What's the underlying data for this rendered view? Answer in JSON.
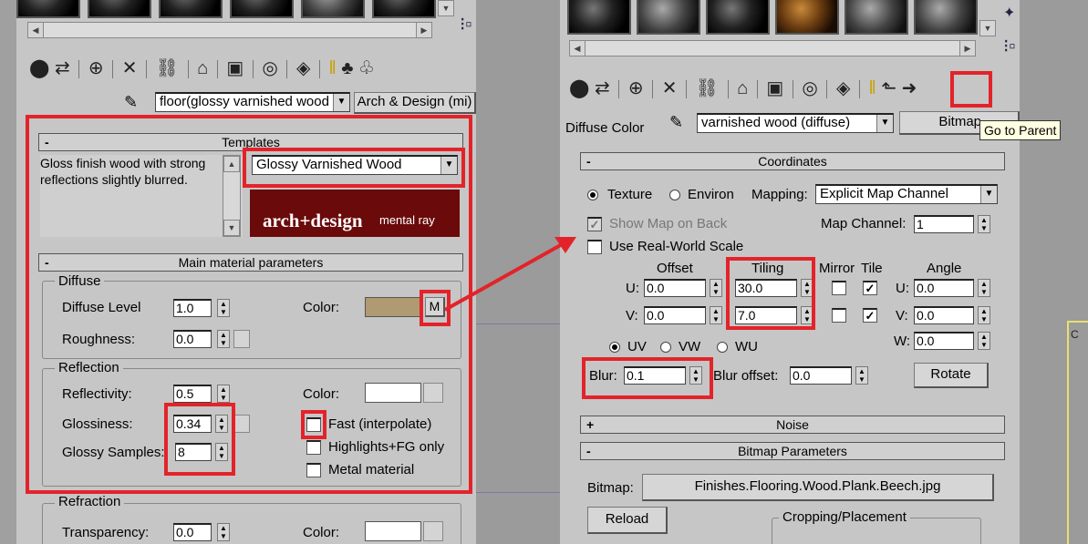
{
  "left": {
    "material_name": "floor(glossy varnished wood",
    "material_type": "Arch & Design (mi)",
    "templates": {
      "title": "Templates",
      "description": "Gloss finish wood with strong reflections slightly blurred.",
      "preset": "Glossy Varnished Wood",
      "logo_main": "arch+design",
      "logo_sub": "mental ray"
    },
    "main_params": {
      "title": "Main material parameters",
      "diffuse": {
        "group": "Diffuse",
        "level_label": "Diffuse Level",
        "level_value": "1.0",
        "roughness_label": "Roughness:",
        "roughness_value": "0.0",
        "color_label": "Color:",
        "color": "#b09a72",
        "map_button": "M"
      },
      "reflection": {
        "group": "Reflection",
        "reflectivity_label": "Reflectivity:",
        "reflectivity_value": "0.5",
        "glossiness_label": "Glossiness:",
        "glossiness_value": "0.34",
        "samples_label": "Glossy Samples:",
        "samples_value": "8",
        "color_label": "Color:",
        "fast_label": "Fast (interpolate)",
        "highlights_label": "Highlights+FG only",
        "metal_label": "Metal material"
      },
      "refraction": {
        "group": "Refraction",
        "transparency_label": "Transparency:",
        "transparency_value": "0.0",
        "color_label": "Color:"
      }
    }
  },
  "right": {
    "slot_label": "Diffuse Color",
    "map_name": "varnished wood (diffuse)",
    "map_type": "Bitmap",
    "tooltip": "Go to Parent",
    "coordinates": {
      "title": "Coordinates",
      "texture_label": "Texture",
      "environ_label": "Environ",
      "mapping_label": "Mapping:",
      "mapping_value": "Explicit Map Channel",
      "show_map_label": "Show Map on Back",
      "map_channel_label": "Map Channel:",
      "map_channel_value": "1",
      "real_world_label": "Use Real-World Scale",
      "offset_header": "Offset",
      "tiling_header": "Tiling",
      "mirror_header": "Mirror",
      "tile_header": "Tile",
      "angle_header": "Angle",
      "u_label": "U:",
      "v_label": "V:",
      "w_label": "W:",
      "u_offset": "0.0",
      "v_offset": "0.0",
      "u_tiling": "30.0",
      "v_tiling": "7.0",
      "u_angle": "0.0",
      "v_angle": "0.0",
      "w_angle": "0.0",
      "uv_label": "UV",
      "vw_label": "VW",
      "wu_label": "WU",
      "blur_label": "Blur:",
      "blur_value": "0.1",
      "blur_offset_label": "Blur offset:",
      "blur_offset_value": "0.0",
      "rotate_label": "Rotate"
    },
    "noise": {
      "title": "Noise"
    },
    "bitmap_params": {
      "title": "Bitmap Parameters",
      "bitmap_label": "Bitmap:",
      "bitmap_file": "Finishes.Flooring.Wood.Plank.Beech.jpg",
      "reload_label": "Reload",
      "cropping_label": "Cropping/Placement"
    }
  },
  "colors": {
    "highlight": "#e3232a",
    "panel": "#c6c6c6",
    "viewport": "#9a9a9a"
  }
}
